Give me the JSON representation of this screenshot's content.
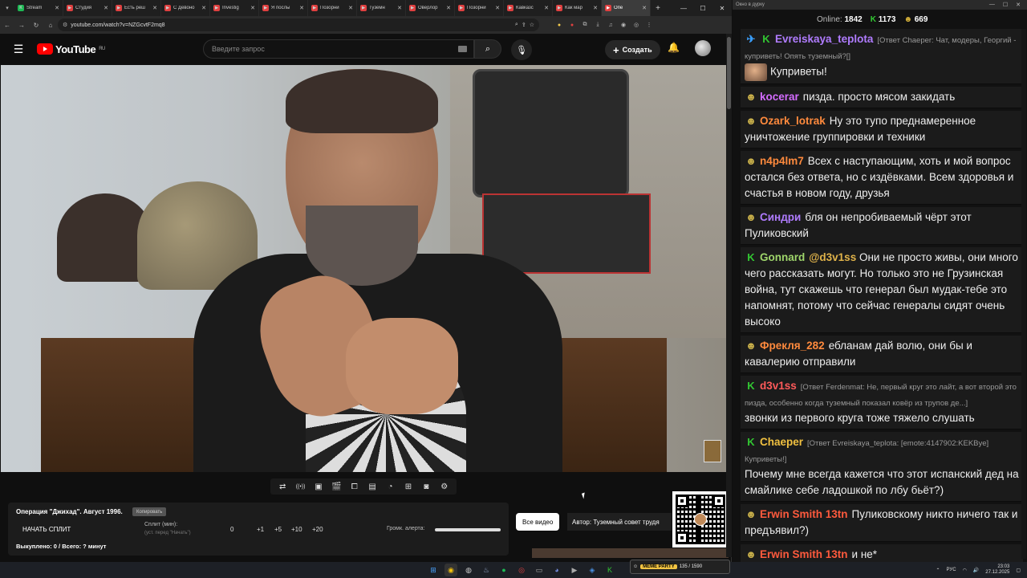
{
  "browser": {
    "tabs": [
      {
        "title": "Stream",
        "color": "#1db954",
        "glyph": "K"
      },
      {
        "title": "Студия",
        "color": "#e04040",
        "glyph": "▶"
      },
      {
        "title": "Есть реш",
        "color": "#e04040",
        "glyph": "▶"
      },
      {
        "title": "С Девоно",
        "color": "#e04040",
        "glyph": "▶"
      },
      {
        "title": "Investig",
        "color": "#e04040",
        "glyph": "▶"
      },
      {
        "title": "Я послы",
        "color": "#e04040",
        "glyph": "▶"
      },
      {
        "title": "Позорни",
        "color": "#e04040",
        "glyph": "▶"
      },
      {
        "title": "Туземн",
        "color": "#e04040",
        "glyph": "▶"
      },
      {
        "title": "Оверлор",
        "color": "#e04040",
        "glyph": "▶"
      },
      {
        "title": "Позорни",
        "color": "#e04040",
        "glyph": "▶"
      },
      {
        "title": "Кавказс",
        "color": "#e04040",
        "glyph": "▶"
      },
      {
        "title": "Как мар",
        "color": "#e04040",
        "glyph": "▶"
      },
      {
        "title": "Опе",
        "color": "#e04040",
        "glyph": "▶",
        "active": true
      }
    ],
    "url": "youtube.com/watch?v=NZGcvtF2mq8"
  },
  "youtube": {
    "logo_text": "YouTube",
    "region": "RU",
    "search_placeholder": "Введите запрос",
    "create_label": "Создать"
  },
  "tools_icons": [
    "repeat-icon",
    "broadcast-icon",
    "screen-icon",
    "clapper-icon",
    "crop-icon",
    "film-icon",
    "speed-icon",
    "add-media-icon",
    "camera-icon",
    "settings-icon"
  ],
  "split": {
    "title": "Операция \"Джихад\". Август 1996.",
    "tag": "Копировать",
    "start_label": "НАЧАТЬ СПЛИТ",
    "split_label": "Сплит (мин):",
    "split_hint": "(уст. перед \"Начать\")",
    "value": "0",
    "increments": [
      "+1",
      "+5",
      "+10",
      "+20"
    ],
    "volume_label": "Громк. алерта:",
    "footer": "Выкуплено: 0 / Всего: ? минут"
  },
  "all_videos_label": "Все видео",
  "author_label": "Автор: Туземный совет трудя",
  "chat": {
    "window_title": "Окно в дурку",
    "online_label": "Online:",
    "online": "1842",
    "kick_count": "1173",
    "other_count": "669",
    "messages": [
      {
        "badge": "✈",
        "badge_color": "#3aa0ff",
        "badge2": "K",
        "name": "Evreiskaya_teplota",
        "color": "#b07cff",
        "reply": "[Ответ Chaeper: Чат, модеры, Георгий - куприветь! Опять туземный?[]",
        "emote": true,
        "text": "Куприветы!"
      },
      {
        "badge": "☻",
        "badge_color": "#c9b04a",
        "name": "kocerar",
        "color": "#d46cff",
        "text": "пизда. просто мясом закидать"
      },
      {
        "badge": "☻",
        "badge_color": "#c9b04a",
        "name": "Ozark_lotrak",
        "color": "#ff8a3d",
        "text": "Ну это тупо преднамеренное уничтожение группировки и техники"
      },
      {
        "badge": "☻",
        "badge_color": "#c9b04a",
        "name": "n4p4lm7",
        "color": "#ff8a3d",
        "text": "Всех с наступающим, хоть и мой вопрос остался без ответа, но с издёвками. Всем здоровья и счастья в новом году, друзья"
      },
      {
        "badge": "☻",
        "badge_color": "#c9b04a",
        "name": "Синдри",
        "color": "#b07cff",
        "text": "бля он непробиваемый чёрт этот Пуликовский"
      },
      {
        "badge": "K",
        "badge_color": "#32c832",
        "name": "Gonnard",
        "color": "#9fd66b",
        "mention": "@d3v1ss",
        "text": "Они не просто живы, они много чего рассказать могут. Но только это не Грузинская война, тут скажешь что генерал был мудак-тебе это напомнят, потому что сейчас генералы сидят очень высоко"
      },
      {
        "badge": "☻",
        "badge_color": "#c9b04a",
        "name": "Фрекля_282",
        "color": "#ff8a3d",
        "text": "ебланам дай волю, они бы и кавалерию отправили"
      },
      {
        "badge": "K",
        "badge_color": "#32c832",
        "name": "d3v1ss",
        "color": "#ff5a5a",
        "reply": "[Ответ Ferdenmat: Не, первый круг это лайт, а вот второй это пизда, особенно когда туземный показал ковёр из трупов де...]",
        "text": "звонки из первого круга тоже тяжело слушать"
      },
      {
        "badge": "K",
        "badge_color": "#32c832",
        "name": "Chaeper",
        "color": "#f0c040",
        "reply": "[Ответ Evreiskaya_teplota: [emote:4147902:KEKBye] Куприветы!]",
        "text": "Почему мне всегда кажется что этот испанский дед на смайлике себе ладошкой по лбу бьёт?)"
      },
      {
        "badge": "☻",
        "badge_color": "#c9b04a",
        "name": "Erwin Smith 13tn",
        "color": "#ff5a3d",
        "text": "Пуликовскому никто ничего так и предъявил?)"
      },
      {
        "badge": "☻",
        "badge_color": "#c9b04a",
        "name": "Erwin Smith 13tn",
        "color": "#ff5a3d",
        "text": "и не*"
      }
    ]
  },
  "meme": {
    "brand": "MEME PARTY",
    "counter": "135 / 1590"
  },
  "taskbar": {
    "lang": "РУС",
    "time": "23:03",
    "date": "27.12.2025"
  }
}
